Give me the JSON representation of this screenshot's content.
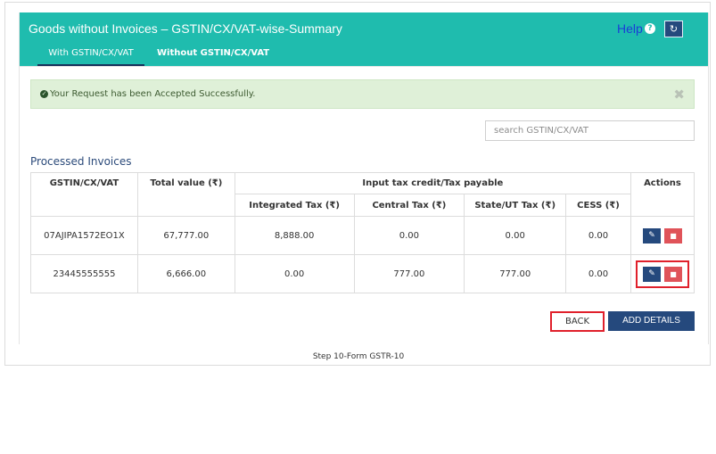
{
  "header": {
    "title": "Goods without Invoices – GSTIN/CX/VAT-wise-Summary",
    "help_label": "Help",
    "help_icon": "question-circle-icon",
    "refresh_icon": "refresh-icon"
  },
  "tabs": [
    {
      "label": "With GSTIN/CX/VAT",
      "active": true
    },
    {
      "label": "Without GSTIN/CX/VAT",
      "active": false
    }
  ],
  "alert": {
    "message": "Your Request has been Accepted Successfully.",
    "close": "✖"
  },
  "search": {
    "placeholder": "search GSTIN/CX/VAT"
  },
  "section": {
    "title": "Processed Invoices"
  },
  "table": {
    "headers": {
      "gstin": "GSTIN/CX/VAT",
      "total": "Total value (₹)",
      "itc_group": "Input tax credit/Tax payable",
      "actions": "Actions",
      "igst": "Integrated Tax (₹)",
      "cgst": "Central Tax (₹)",
      "sgst": "State/UT Tax (₹)",
      "cess": "CESS (₹)"
    },
    "rows": [
      {
        "gstin": "07AJIPA1572EO1X",
        "total": "67,777.00",
        "igst": "8,888.00",
        "cgst": "0.00",
        "sgst": "0.00",
        "cess": "0.00"
      },
      {
        "gstin": "23445555555",
        "total": "6,666.00",
        "igst": "0.00",
        "cgst": "777.00",
        "sgst": "777.00",
        "cess": "0.00"
      }
    ]
  },
  "buttons": {
    "back": "BACK",
    "add_details": "ADD DETAILS"
  },
  "caption": "Step 10-Form GSTR-10",
  "colors": {
    "header_bg": "#1fbcae",
    "primary_btn": "#25497d",
    "delete_btn": "#e05359",
    "highlight_border": "#e0202b",
    "alert_bg": "#dff0d8"
  }
}
